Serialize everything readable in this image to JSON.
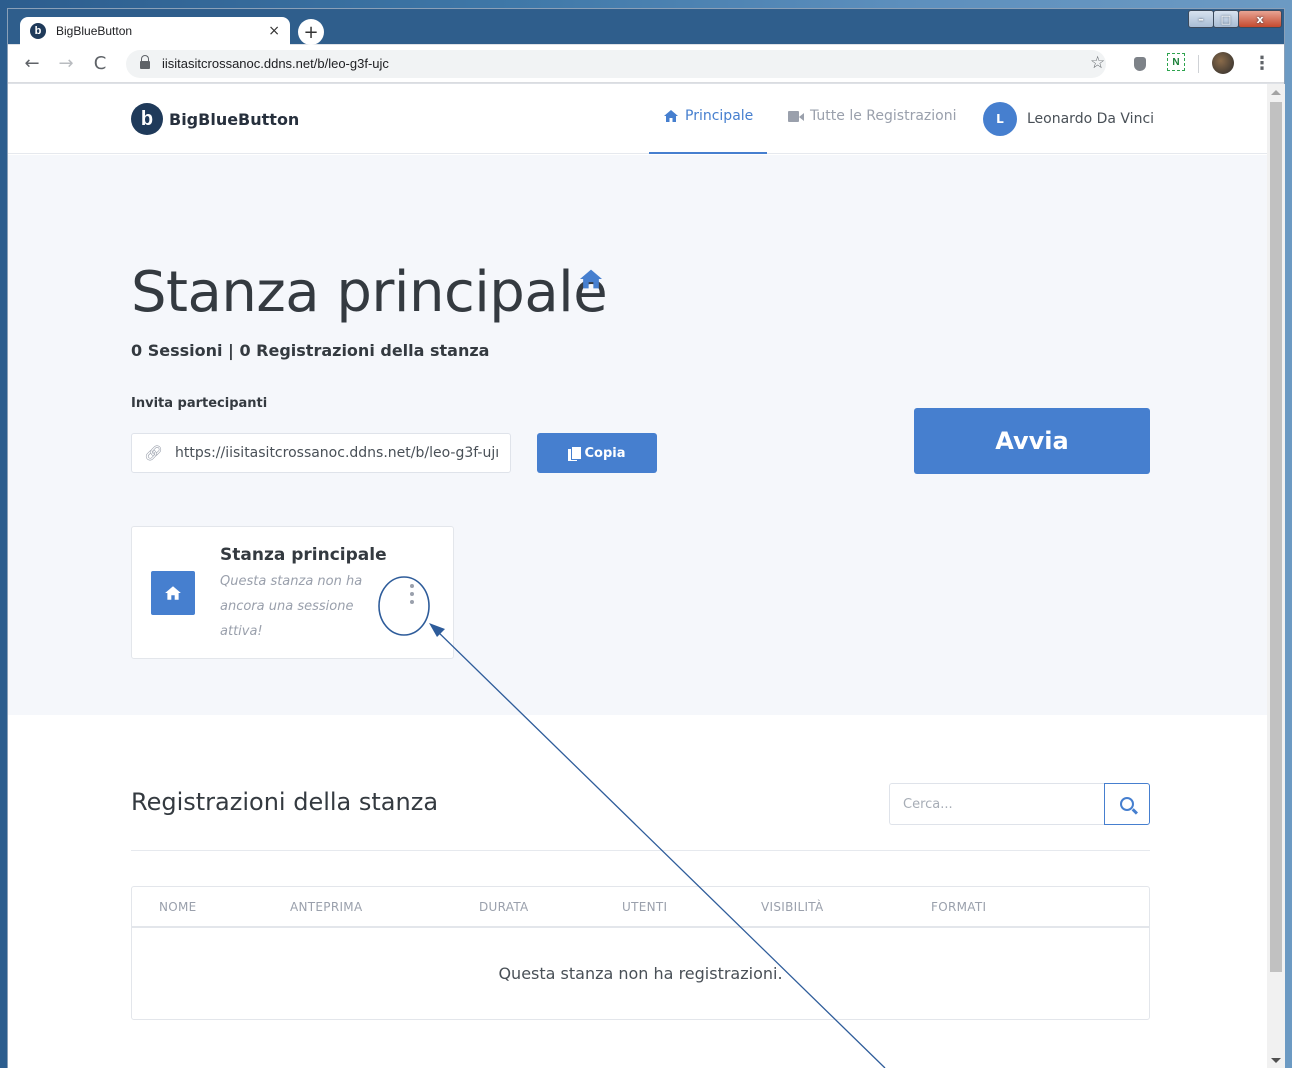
{
  "browser": {
    "tab_title": "BigBlueButton",
    "tab_close": "×",
    "new_tab": "+",
    "url": "iisitasitcrossanoc.ddns.net/b/leo-g3f-ujc",
    "extension_label": "N",
    "back": "←",
    "forward": "→",
    "reload": "C",
    "star": "☆",
    "menu": "⋮"
  },
  "window_controls": {
    "minimize": "–",
    "maximize": "□",
    "close": "x"
  },
  "site": {
    "brand": "BigBlueButton",
    "brand_logo_letter": "b",
    "nav": {
      "home_label": "Principale",
      "recordings_label": "Tutte le Registrazioni"
    },
    "user": {
      "initial": "L",
      "name": "Leonardo Da Vinci"
    }
  },
  "room": {
    "title": "Stanza principale",
    "meta": "0 Sessioni | 0 Registrazioni della stanza",
    "invite_label": "Invita partecipanti",
    "invite_url": "https://iisitasitcrossanoc.ddns.net/b/leo-g3f-ujı",
    "copy_label": "Copia",
    "start_label": "Avvia",
    "card": {
      "title": "Stanza principale",
      "description": "Questa stanza non ha ancora una sessione attiva!"
    }
  },
  "recordings": {
    "title": "Registrazioni della stanza",
    "search_placeholder": "Cerca...",
    "columns": [
      "NOME",
      "ANTEPRIMA",
      "DURATA",
      "UTENTI",
      "VISIBILITÀ",
      "FORMATI"
    ],
    "empty_message": "Questa stanza non ha registrazioni."
  },
  "colors": {
    "accent": "#467fcf",
    "hero_bg": "#f5f7fb",
    "annotation": "#2e5c9a"
  },
  "icons": {
    "home": "home-icon",
    "video": "video-camera-icon",
    "link": "link-icon",
    "copy": "copy-icon",
    "search": "search-icon",
    "kebab": "kebab-menu-icon"
  }
}
